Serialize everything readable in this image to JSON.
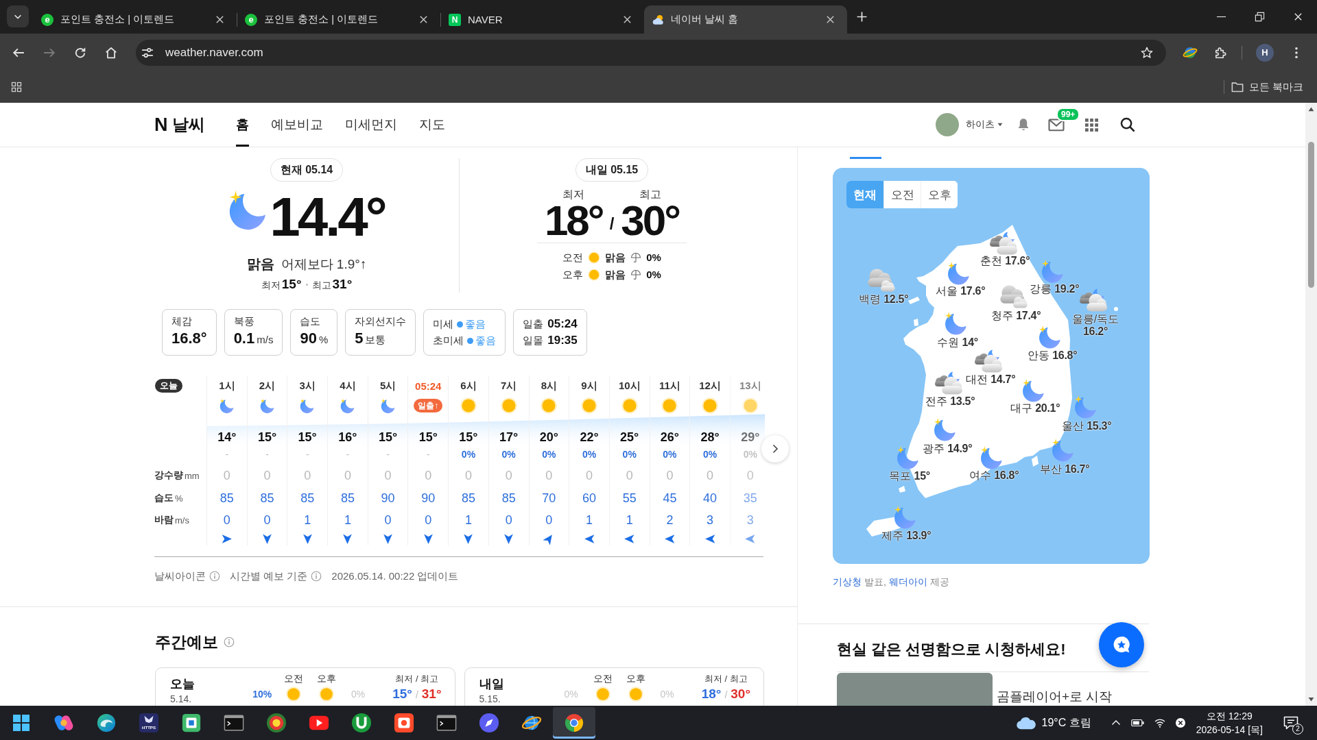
{
  "browser": {
    "tabs": [
      {
        "title": "포인트 충전소 | 이토렌드",
        "kind": "circle-letter",
        "letter": "e",
        "selected": false
      },
      {
        "title": "포인트 충전소 | 이토렌드",
        "kind": "circle-letter",
        "letter": "e",
        "selected": false
      },
      {
        "title": "NAVER",
        "kind": "square-letter",
        "letter": "N",
        "selected": false
      },
      {
        "title": "네이버 날씨 홈",
        "kind": "weather",
        "selected": true
      }
    ],
    "forward_disabled": true,
    "address": "weather.naver.com",
    "profile": "H",
    "bookmarks_folder": "모든 북마크"
  },
  "header": {
    "logo_mark": "N",
    "logo_text": "날씨",
    "nav": [
      {
        "label": "홈",
        "selected": true
      },
      {
        "label": "예보비교",
        "selected": false
      },
      {
        "label": "미세먼지",
        "selected": false
      },
      {
        "label": "지도",
        "selected": false
      }
    ],
    "user": "하이츠",
    "mail_badge": "99+"
  },
  "current": {
    "date": "현재 05.14",
    "temp": "14.4°",
    "condition": "맑음",
    "compare": "어제보다 1.9°↑",
    "low": "최저**15°**",
    "high": "최고**31°**"
  },
  "tomorrow": {
    "date": "내일 05.15",
    "low_label": "최저",
    "high_label": "최고",
    "low": "18°",
    "separator": "/",
    "high": "30°",
    "periods": [
      {
        "label": "오전",
        "condition": "맑음",
        "rain": "0%"
      },
      {
        "label": "오후",
        "condition": "맑음",
        "rain": "0%"
      }
    ]
  },
  "summary": [
    {
      "kind": "stat",
      "label": "체감",
      "value": "16.8°"
    },
    {
      "kind": "stat",
      "label": "북풍",
      "value": "0.1",
      "unit": "m/s"
    },
    {
      "kind": "stat",
      "label": "습도",
      "value": "90",
      "unit": "%"
    },
    {
      "kind": "stat",
      "label": "자외선지수",
      "value": "5",
      "unit": "보통"
    },
    {
      "kind": "air",
      "lines": [
        {
          "label": "미세",
          "status": "좋음",
          "color": "#3d9cf5"
        },
        {
          "label": "초미세",
          "status": "좋음",
          "color": "#3d9cf5"
        }
      ]
    },
    {
      "kind": "sun",
      "lines": [
        {
          "label": "일출",
          "value": "05:24"
        },
        {
          "label": "일몰",
          "value": "19:35"
        }
      ]
    }
  ],
  "hourly": {
    "day_badge": "오늘",
    "row_labels": [
      {
        "label": "강수량",
        "unit": "mm"
      },
      {
        "label": "습도",
        "unit": "%"
      },
      {
        "label": "바람",
        "unit": "m/s"
      }
    ],
    "hours": [
      {
        "kind": "night",
        "time": "1시",
        "temp": "14°",
        "chance": "-",
        "chance_muted": true,
        "rain": "0",
        "humidity": "85",
        "wind": "0"
      },
      {
        "kind": "night",
        "time": "2시",
        "temp": "15°",
        "chance": "-",
        "chance_muted": true,
        "rain": "0",
        "humidity": "85",
        "wind": "0"
      },
      {
        "kind": "night",
        "time": "3시",
        "temp": "15°",
        "chance": "-",
        "chance_muted": true,
        "rain": "0",
        "humidity": "85",
        "wind": "1"
      },
      {
        "kind": "night",
        "time": "4시",
        "temp": "16°",
        "chance": "-",
        "chance_muted": true,
        "rain": "0",
        "humidity": "85",
        "wind": "1"
      },
      {
        "kind": "night",
        "time": "5시",
        "temp": "15°",
        "chance": "-",
        "chance_muted": true,
        "rain": "0",
        "humidity": "90",
        "wind": "0"
      },
      {
        "kind": "sunrise",
        "time": "05:24",
        "badge": "일출↑",
        "temp": "15°",
        "chance": "-",
        "chance_muted": true,
        "rain": "0",
        "humidity": "90",
        "wind": "0"
      },
      {
        "kind": "day",
        "time": "6시",
        "temp": "15°",
        "chance": "0%",
        "chance_muted": false,
        "rain": "0",
        "humidity": "85",
        "wind": "1"
      },
      {
        "kind": "day",
        "time": "7시",
        "temp": "17°",
        "chance": "0%",
        "chance_muted": false,
        "rain": "0",
        "humidity": "85",
        "wind": "0"
      },
      {
        "kind": "day",
        "time": "8시",
        "temp": "20°",
        "chance": "0%",
        "chance_muted": false,
        "rain": "0",
        "humidity": "70",
        "wind": "0"
      },
      {
        "kind": "day",
        "time": "9시",
        "temp": "22°",
        "chance": "0%",
        "chance_muted": false,
        "rain": "0",
        "humidity": "60",
        "wind": "1"
      },
      {
        "kind": "day",
        "time": "10시",
        "temp": "25°",
        "chance": "0%",
        "chance_muted": false,
        "rain": "0",
        "humidity": "55",
        "wind": "1"
      },
      {
        "kind": "day",
        "time": "11시",
        "temp": "26°",
        "chance": "0%",
        "chance_muted": false,
        "rain": "0",
        "humidity": "45",
        "wind": "2"
      },
      {
        "kind": "day",
        "time": "12시",
        "temp": "28°",
        "chance": "0%",
        "chance_muted": false,
        "rain": "0",
        "humidity": "40",
        "wind": "3"
      },
      {
        "kind": "day",
        "time": "13시",
        "temp": "29°",
        "chance": "0%",
        "chance_muted": false,
        "rain": "0",
        "humidity": "35",
        "wind": "3"
      }
    ]
  },
  "hourly_footer": [
    {
      "text": "날씨아이콘",
      "info": true
    },
    {
      "text": "시간별 예보 기준",
      "info": true
    },
    {
      "text": "2026.05.14. 00:22 업데이트",
      "info": false
    }
  ],
  "weekly": {
    "title": "주간예보",
    "days": [
      {
        "day": "오늘",
        "date": "5.14.",
        "am_label": "오전",
        "pm_label": "오후",
        "am_chance": "10%",
        "am_chance_muted": false,
        "pm_chance": "0%",
        "pm_chance_muted": true,
        "range_label": "최저 / 최고",
        "low": "15°",
        "separator": "/",
        "high": "31°"
      },
      {
        "day": "내일",
        "date": "5.15.",
        "am_label": "오전",
        "pm_label": "오후",
        "am_chance": "0%",
        "am_chance_muted": true,
        "pm_chance": "0%",
        "pm_chance_muted": true,
        "range_label": "최저 / 최고",
        "low": "18°",
        "separator": "/",
        "high": "30°"
      }
    ]
  },
  "map": {
    "periods": [
      {
        "label": "현재",
        "selected": true
      },
      {
        "label": "오전",
        "selected": false
      },
      {
        "label": "오후",
        "selected": false
      }
    ],
    "cities": [
      {
        "name": "춘천",
        "temp": "17.6°",
        "kind": "partly-cloudy"
      },
      {
        "name": "서울",
        "temp": "17.6°",
        "kind": "clear"
      },
      {
        "name": "강릉",
        "temp": "19.2°",
        "kind": "clear"
      },
      {
        "name": "백령",
        "temp": "12.5°",
        "kind": "cloudy"
      },
      {
        "name": "청주",
        "temp": "17.4°",
        "kind": "cloudy"
      },
      {
        "name": "울릉/독도",
        "temp": "16.2°",
        "kind": "partly-cloudy"
      },
      {
        "name": "수원",
        "temp": "14°",
        "kind": "clear"
      },
      {
        "name": "안동",
        "temp": "16.8°",
        "kind": "clear"
      },
      {
        "name": "대전",
        "temp": "14.7°",
        "kind": "partly-cloudy"
      },
      {
        "name": "전주",
        "temp": "13.5°",
        "kind": "partly-cloudy"
      },
      {
        "name": "대구",
        "temp": "20.1°",
        "kind": "clear"
      },
      {
        "name": "울산",
        "temp": "15.3°",
        "kind": "clear"
      },
      {
        "name": "광주",
        "temp": "14.9°",
        "kind": "clear"
      },
      {
        "name": "부산",
        "temp": "16.7°",
        "kind": "clear"
      },
      {
        "name": "목포",
        "temp": "15°",
        "kind": "clear"
      },
      {
        "name": "여수",
        "temp": "16.8°",
        "kind": "clear"
      },
      {
        "name": "제주",
        "temp": "13.9°",
        "kind": "clear"
      }
    ],
    "credit": [
      {
        "text": "기상청",
        "kind": "link"
      },
      {
        "text": "발표,",
        "kind": "text"
      },
      {
        "text": "웨더아이",
        "kind": "link"
      },
      {
        "text": "제공",
        "kind": "text"
      }
    ]
  },
  "promo": {
    "title": "현실 같은 선명함으로 시청하세요!",
    "caption": "곰플레이어+로 시작"
  },
  "taskbar": {
    "apps": [
      {
        "kind": "swirl",
        "selected": false
      },
      {
        "kind": "wave",
        "selected": false
      },
      {
        "kind": "badge",
        "label": "HTTPS",
        "selected": false
      },
      {
        "kind": "square",
        "selected": false
      },
      {
        "kind": "terminal",
        "selected": false
      },
      {
        "kind": "emblem",
        "selected": false
      },
      {
        "kind": "video",
        "selected": false
      },
      {
        "kind": "torrent",
        "selected": false
      },
      {
        "kind": "photo",
        "selected": false
      },
      {
        "kind": "terminal",
        "selected": false
      },
      {
        "kind": "compass",
        "selected": false
      },
      {
        "kind": "globe",
        "selected": false
      },
      {
        "kind": "browser",
        "selected": true
      }
    ],
    "weather": "19°C 흐림",
    "time": "오전 12:29",
    "date": "2026-05-14 [목]",
    "notifications": "2"
  }
}
